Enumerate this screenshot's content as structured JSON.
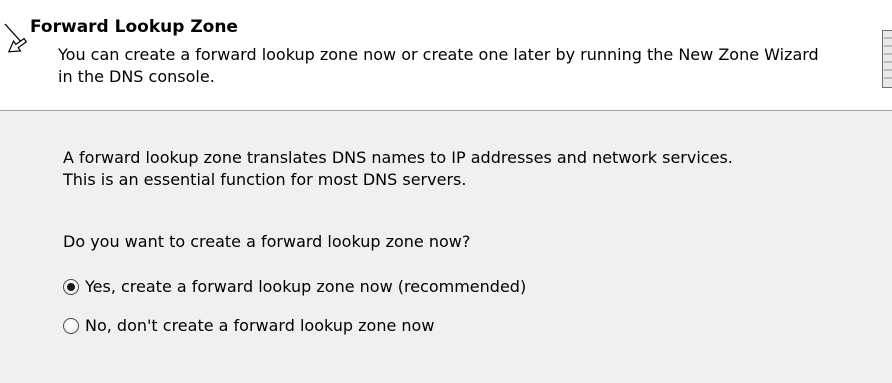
{
  "header": {
    "title": "Forward Lookup Zone",
    "subtitle": "You can create a forward lookup zone now or create one later by running the New Zone Wizard in the DNS console."
  },
  "body": {
    "description": "A forward lookup zone translates DNS names to IP addresses and network services.\nThis is an essential function for most DNS servers.",
    "question": "Do you want to create a forward lookup zone now?"
  },
  "options": [
    {
      "label": "Yes, create a forward lookup zone now (recommended)",
      "selected": true
    },
    {
      "label": "No, don't create a forward lookup zone now",
      "selected": false
    }
  ]
}
